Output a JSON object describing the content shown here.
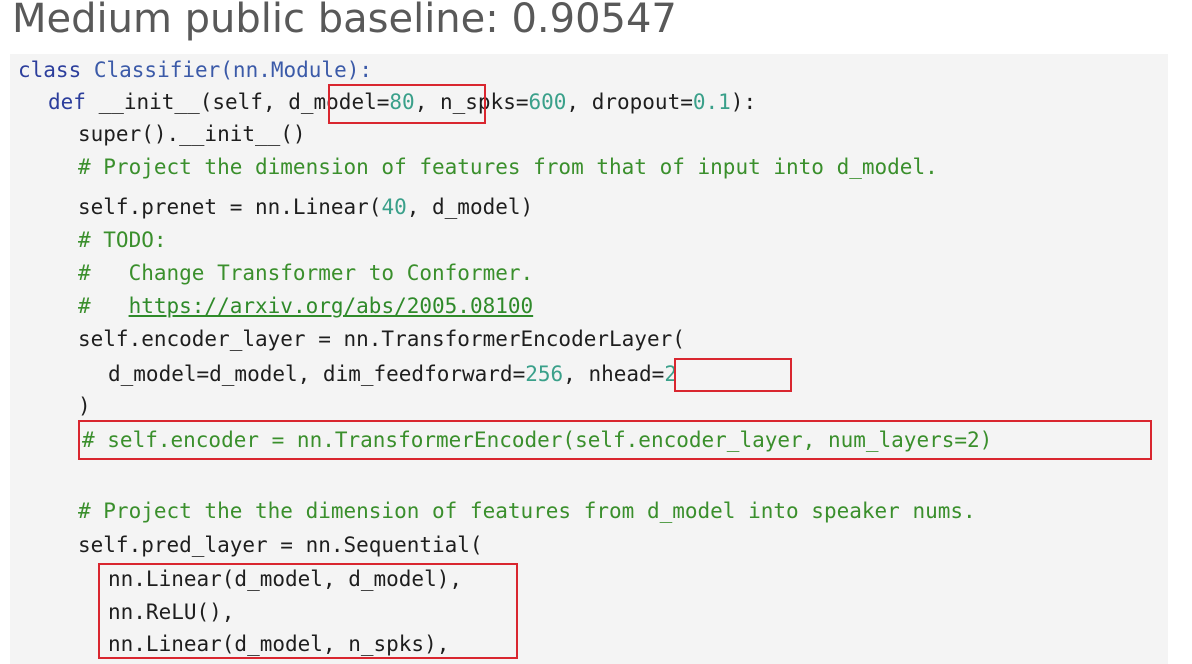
{
  "title": "Medium public baseline: 0.90547",
  "code": {
    "l1_kw": "class ",
    "l1_name": "Classifier(nn.Module):",
    "l2_kw": "def ",
    "l2_a": "__init__(self, ",
    "l2_dmodel": "d_model=",
    "l2_dmodel_val": "80",
    "l2_b": ", n_spks=",
    "l2_spks_val": "600",
    "l2_c": ", dropout=",
    "l2_drop_val": "0.1",
    "l2_d": "):",
    "l3": "super().__init__()",
    "l4": "# Project the dimension of features from that of input into d_model.",
    "l5_a": "self.prenet = nn.Linear(",
    "l5_num": "40",
    "l5_b": ", d_model)",
    "l6": "# TODO:",
    "l7": "#   Change Transformer to Conformer.",
    "l8_hash": "#   ",
    "l8_url": "https://arxiv.org/abs/2005.08100",
    "l9": "self.encoder_layer = nn.TransformerEncoderLayer(",
    "l10_a": "d_model=d_model, dim_feedforward=",
    "l10_num": "256",
    "l10_b": ", ",
    "l10_nhead": "nhead=",
    "l10_nhead_val": "2",
    "l11": ")",
    "l12": "# self.encoder = nn.TransformerEncoder(self.encoder_layer, num_layers=2)",
    "l13": "# Project the the dimension of features from d_model into speaker nums.",
    "l14": "self.pred_layer = nn.Sequential(",
    "l15": "nn.Linear(d_model, d_model),",
    "l16": "nn.ReLU(),",
    "l17": "nn.Linear(d_model, n_spks),"
  }
}
